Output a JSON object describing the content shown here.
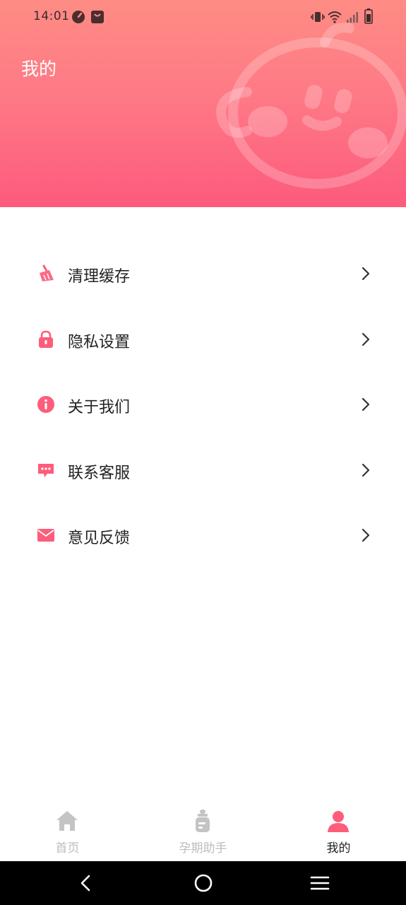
{
  "status_bar": {
    "time": "14:01",
    "left_icons": [
      "speedometer-icon",
      "bag-icon"
    ],
    "right_icons": [
      "vibrate-icon",
      "wifi-icon",
      "signal-icon",
      "battery-icon"
    ]
  },
  "header": {
    "title": "我的",
    "mascot_icon": "baby-face-icon",
    "gradient_colors": [
      "#fe8c84",
      "#fd5a7c"
    ]
  },
  "menu": {
    "items": [
      {
        "label": "清理缓存",
        "icon": "broom-icon"
      },
      {
        "label": "隐私设置",
        "icon": "lock-icon"
      },
      {
        "label": "关于我们",
        "icon": "info-icon"
      },
      {
        "label": "联系客服",
        "icon": "chat-bubble-icon"
      },
      {
        "label": "意见反馈",
        "icon": "mail-icon"
      }
    ],
    "arrow_icon": "chevron-right-icon",
    "accent_color": "#fd5d7b"
  },
  "tabbar": {
    "tabs": [
      {
        "label": "首页",
        "icon": "home-icon",
        "active": false
      },
      {
        "label": "孕期助手",
        "icon": "baby-bottle-icon",
        "active": false
      },
      {
        "label": "我的",
        "icon": "person-icon",
        "active": true
      }
    ],
    "inactive_color": "#bdbdbd",
    "active_color": "#fd5d7b"
  },
  "nav_bar": {
    "buttons": [
      "back-icon",
      "home-circle-icon",
      "menu-lines-icon"
    ]
  }
}
